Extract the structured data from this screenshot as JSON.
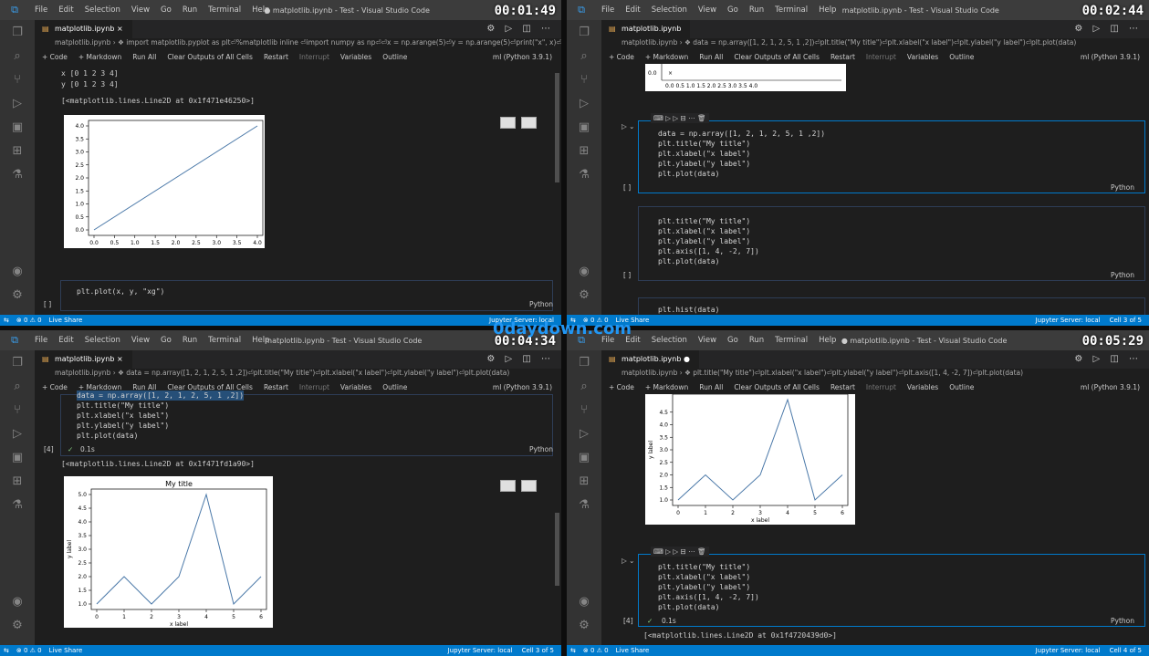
{
  "app": {
    "menu": [
      "File",
      "Edit",
      "Selection",
      "View",
      "Go",
      "Run",
      "Terminal",
      "Help"
    ]
  },
  "toolbar": {
    "code": "+ Code",
    "markdown": "+ Markdown",
    "run_all": "Run All",
    "clear": "Clear Outputs of All Cells",
    "restart": "Restart",
    "interrupt": "Interrupt",
    "variables": "Variables",
    "outline": "Outline",
    "kernel": "ml (Python 3.9.1)"
  },
  "watermark": "0daydown.com",
  "panes": [
    {
      "title": "● matplotlib.ipynb - Test - Visual Studio Code",
      "timer": "00:01:49",
      "tab": "matplotlib.ipynb",
      "crumb": "matplotlib.ipynb › ❖ import matplotlib.pyplot as plt⏎%matplotlib inline ⏎import numpy as np⏎⏎x = np.arange(5)⏎y = np.arange(5)⏎print(\"x\", x)⏎prin...",
      "out1": "x [0 1 2 3 4]",
      "out2": "y [0 1 2 3 4]",
      "out3": "[<matplotlib.lines.Line2D at 0x1f471e46250>]",
      "code": "plt.plot(x, y, \"xg\")",
      "lang": "Python",
      "exec": "[ ]",
      "status": {
        "err": "⊗ 0 ⚠ 0",
        "live": "Live Share",
        "jup": "Jupyter Server: local"
      }
    },
    {
      "title": "matplotlib.ipynb - Test - Visual Studio Code",
      "timer": "00:02:44",
      "tab": "matplotlib.ipynb",
      "crumb": "matplotlib.ipynb › ❖ data = np.array([1, 2, 1, 2, 5, 1 ,2])⏎plt.title(\"My title\")⏎plt.xlabel(\"x label\")⏎plt.ylabel(\"y label\")⏎plt.plot(data)",
      "c1": [
        "data = np.array([1, 2, 1, 2, 5, 1 ,2])",
        "plt.title(\"My title\")",
        "plt.xlabel(\"x label\")",
        "plt.ylabel(\"y label\")",
        "plt.plot(data)"
      ],
      "c2": [
        "plt.title(\"My title\")",
        "plt.xlabel(\"x label\")",
        "plt.ylabel(\"y label\")",
        "plt.axis([1, 4, -2, 7])",
        "plt.plot(data)"
      ],
      "c3": "plt.hist(data)",
      "lang": "Python",
      "exec": "[ ]",
      "status": {
        "err": "⊗ 0 ⚠ 0",
        "live": "Live Share",
        "jup": "Jupyter Server: local",
        "cell": "Cell 3 of 5"
      }
    },
    {
      "title": "matplotlib.ipynb - Test - Visual Studio Code",
      "timer": "00:04:34",
      "tab": "matplotlib.ipynb",
      "crumb": "matplotlib.ipynb › ❖ data = np.array([1, 2, 1, 2, 5, 1 ,2])⏎plt.title(\"My title\")⏎plt.xlabel(\"x label\")⏎plt.ylabel(\"y label\")⏎plt.plot(data)",
      "c1": [
        "data = np.array([1, 2, 1, 2, 5, 1 ,2])",
        "plt.title(\"My title\")",
        "plt.xlabel(\"x label\")",
        "plt.ylabel(\"y label\")",
        "plt.plot(data)"
      ],
      "exec": "[4]",
      "time": "0.1s",
      "out": "[<matplotlib.lines.Line2D at 0x1f471fd1a90>]",
      "lang": "Python",
      "status": {
        "err": "⊗ 0 ⚠ 0",
        "live": "Live Share",
        "jup": "Jupyter Server: local",
        "cell": "Cell 3 of 5"
      }
    },
    {
      "title": "● matplotlib.ipynb - Test - Visual Studio Code",
      "timer": "00:05:29",
      "tab": "matplotlib.ipynb",
      "crumb": "matplotlib.ipynb › ❖ plt.title(\"My title\")⏎plt.xlabel(\"x label\")⏎plt.ylabel(\"y label\")⏎plt.axis([1, 4, -2, 7])⏎plt.plot(data)",
      "c1": [
        "plt.title(\"My title\")",
        "plt.xlabel(\"x label\")",
        "plt.ylabel(\"y label\")",
        "plt.axis([1, 4, -2, 7])",
        "plt.plot(data)"
      ],
      "exec": "[4]",
      "time": "0.1s",
      "out": "[<matplotlib.lines.Line2D at 0x1f4720439d0>]",
      "lang": "Python",
      "status": {
        "err": "⊗ 0 ⚠ 0",
        "live": "Live Share",
        "jup": "Jupyter Server: local",
        "cell": "Cell 4 of 5"
      }
    }
  ],
  "chart_data": [
    {
      "type": "line",
      "x": [
        0,
        4
      ],
      "y": [
        0,
        4
      ],
      "xticks": [
        "0.0",
        "0.5",
        "1.0",
        "1.5",
        "2.0",
        "2.5",
        "3.0",
        "3.5",
        "4.0"
      ],
      "yticks": [
        "0.0",
        "0.5",
        "1.0",
        "1.5",
        "2.0",
        "2.5",
        "3.0",
        "3.5",
        "4.0"
      ],
      "xlim": [
        0,
        4
      ],
      "ylim": [
        0,
        4
      ]
    },
    {
      "type": "line",
      "title": "My title",
      "xlabel": "x label",
      "ylabel": "y label",
      "x": [
        0,
        1,
        2,
        3,
        4,
        5,
        6
      ],
      "y": [
        1,
        2,
        1,
        2,
        5,
        1,
        2
      ],
      "xticks": [
        "0",
        "1",
        "2",
        "3",
        "4",
        "5",
        "6"
      ],
      "yticks": [
        "1.0",
        "1.5",
        "2.0",
        "2.5",
        "3.0",
        "3.5",
        "4.0",
        "4.5",
        "5.0"
      ],
      "xlim": [
        0,
        6
      ],
      "ylim": [
        1,
        5
      ]
    },
    {
      "type": "line",
      "xlabel": "x label",
      "ylabel": "y label",
      "x": [
        0,
        1,
        2,
        3,
        4,
        5,
        6
      ],
      "y": [
        1,
        2,
        1,
        2,
        5,
        1,
        2
      ],
      "xticks": [
        "0",
        "1",
        "2",
        "3",
        "4",
        "5",
        "6"
      ],
      "yticks": [
        "1.0",
        "1.5",
        "2.0",
        "2.5",
        "3.0",
        "3.5",
        "4.0",
        "4.5"
      ],
      "xlim": [
        0,
        6
      ],
      "ylim": [
        1,
        5
      ]
    }
  ]
}
